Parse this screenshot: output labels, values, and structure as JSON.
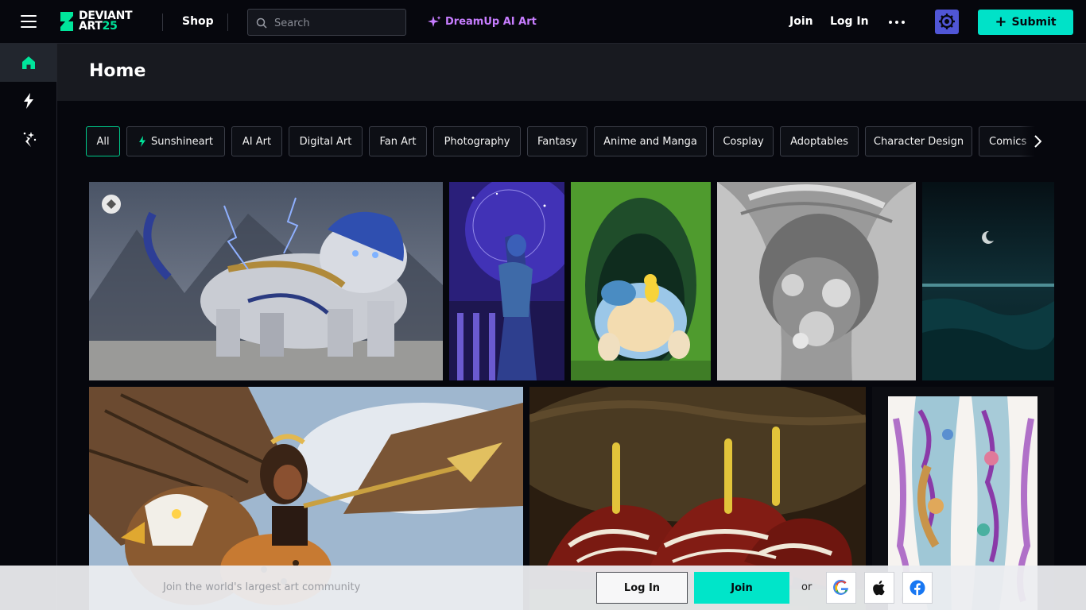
{
  "header": {
    "logo_line1": "DEVIANT",
    "logo_line2": "ART",
    "logo_badge": "25",
    "shop_label": "Shop",
    "search_placeholder": "Search",
    "dreamup_label": "DreamUp AI Art",
    "join_label": "Join",
    "login_label": "Log In",
    "submit_label": "Submit"
  },
  "sidebar": {
    "items": [
      {
        "icon": "home-icon",
        "active": true
      },
      {
        "icon": "lightning-icon",
        "active": false
      },
      {
        "icon": "dreamup-icon",
        "active": false
      }
    ]
  },
  "page": {
    "title": "Home"
  },
  "filters": {
    "chips": [
      "All",
      "Sunshineart",
      "AI Art",
      "Digital Art",
      "Fan Art",
      "Photography",
      "Fantasy",
      "Anime and Manga",
      "Cosplay",
      "Adoptables",
      "Character Design",
      "Comics"
    ],
    "active": "All"
  },
  "gallery": {
    "rows": [
      [
        "armored-tiger-artwork",
        "witch-night-artwork",
        "snorlax-pikachu-artwork",
        "fractal-sculpture-artwork",
        "moonlit-sea-artwork"
      ],
      [
        "griffin-warrior-artwork",
        "anthurium-flowers-artwork",
        "tattoo-legs-artwork"
      ]
    ]
  },
  "banner": {
    "text": "Join the world's largest art community",
    "login_label": "Log In",
    "join_label": "Join",
    "or_label": "or",
    "social": [
      "google-icon",
      "apple-icon",
      "facebook-icon"
    ]
  },
  "colors": {
    "background": "#06070d",
    "accent_green": "#00e59b",
    "submit_teal": "#00e2c8",
    "dreamup_purple": "#c77dff",
    "core_badge": "#5056d6"
  }
}
